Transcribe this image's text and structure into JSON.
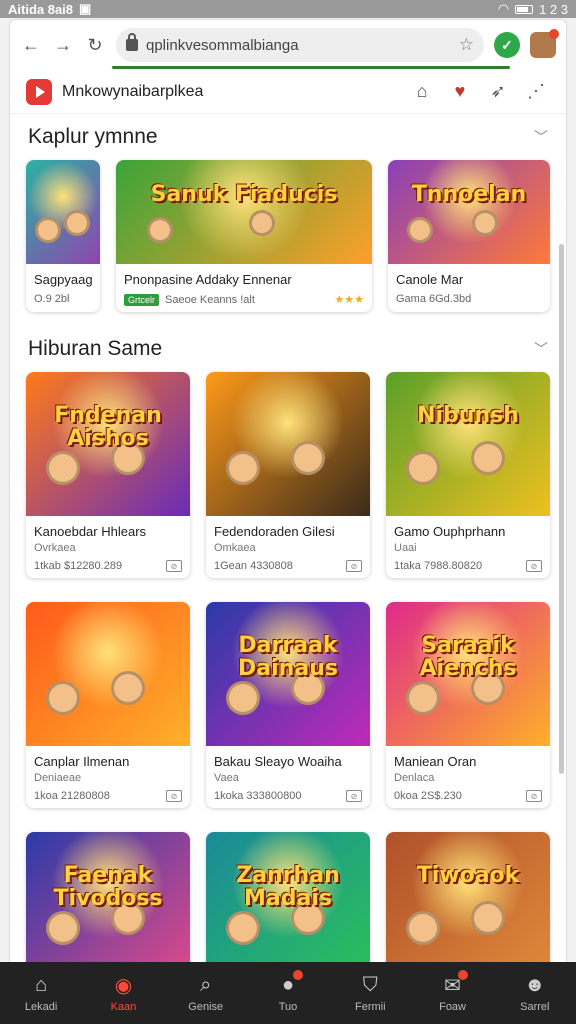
{
  "status_bar": {
    "time_label": "Aitida 8ai8",
    "right_text": "1 2 3"
  },
  "browser": {
    "url": "qplinkvesommalbianga",
    "colors": {
      "accent": "#2e7d32",
      "shield": "#2ea84a"
    }
  },
  "site": {
    "title": "Mnkowynaibarplkea"
  },
  "sections": [
    {
      "title": "Kaplur ymnne",
      "cards": [
        {
          "title": "Sagpyaag",
          "sub": "O.9 2bl",
          "art_text": "",
          "colors": [
            "#2bb3a3",
            "#8e44ad"
          ]
        },
        {
          "title": "Pnonpasine Addaky Ennenar",
          "tag": "Grtcelr",
          "sub": "Saeoe Keanns !alt",
          "rating": "★★★",
          "art_text": "Sanuk Fiaducis",
          "colors": [
            "#3aa43a",
            "#ff9f2a"
          ]
        },
        {
          "title": "Canole Mar",
          "sub": "Gama 6Gd.3bd",
          "art_text": "Tnnoelan",
          "colors": [
            "#8a3fb8",
            "#ff7a3a"
          ]
        }
      ]
    },
    {
      "title": "Hiburan Same",
      "cards": [
        {
          "title": "Kanoebdar Hhlears",
          "sub": "Ovrkaea",
          "meta": "1tkab $12280.289",
          "art_text": "Fndenan Aishos",
          "colors": [
            "#ff7a1a",
            "#6a2bb8"
          ]
        },
        {
          "title": "Fedendoraden Gilesi",
          "sub": "Omkaea",
          "meta": "1Gean 4330808",
          "art_text": "",
          "colors": [
            "#ff9a1a",
            "#3a2a1a"
          ]
        },
        {
          "title": "Gamo Ouphprhann",
          "sub": "Uaai",
          "meta": "1taka 7988.80820",
          "art_text": "Nibunsh",
          "colors": [
            "#5aa02a",
            "#f0c020"
          ]
        },
        {
          "title": "Canplar Ilmenan",
          "sub": "Deniaeae",
          "meta": "1koa 21280808",
          "art_text": "",
          "colors": [
            "#ff5a1a",
            "#ffb02a"
          ]
        },
        {
          "title": "Bakau Sleayo Woaiha",
          "sub": "Vaea",
          "meta": "1koka 333800800",
          "art_text": "Darraak Dainaus",
          "colors": [
            "#2a3aa8",
            "#c02ab8"
          ]
        },
        {
          "title": "Maniean Oran",
          "sub": "Denlaca",
          "meta": "0koa 2S$.230",
          "art_text": "Saraaik Aienchs",
          "colors": [
            "#e02a8a",
            "#ffb02a"
          ]
        },
        {
          "title": "",
          "sub": "",
          "meta": "",
          "art_text": "Faenak Tivodoss",
          "colors": [
            "#2a3aa8",
            "#e04a8a"
          ]
        },
        {
          "title": "",
          "sub": "",
          "meta": "",
          "art_text": "Zanrhan Madais",
          "colors": [
            "#1a8a9a",
            "#2ac05a"
          ]
        },
        {
          "title": "",
          "sub": "",
          "meta": "",
          "art_text": "Tiwoaok",
          "colors": [
            "#b0502a",
            "#e08a3a"
          ]
        }
      ]
    }
  ],
  "bottom_nav": [
    {
      "label": "Lekadi",
      "icon": "home-icon",
      "glyph": "⌂"
    },
    {
      "label": "Kaan",
      "icon": "game-icon",
      "glyph": "◉",
      "active": true
    },
    {
      "label": "Genise",
      "icon": "search-icon",
      "glyph": "⌕"
    },
    {
      "label": "Tuo",
      "icon": "notification-icon",
      "glyph": "●",
      "badge": true
    },
    {
      "label": "Fermii",
      "icon": "person-icon",
      "glyph": "⛉"
    },
    {
      "label": "Foaw",
      "icon": "chat-icon",
      "glyph": "✉",
      "badge": true
    },
    {
      "label": "Sarrel",
      "icon": "account-icon",
      "glyph": "☻"
    }
  ]
}
